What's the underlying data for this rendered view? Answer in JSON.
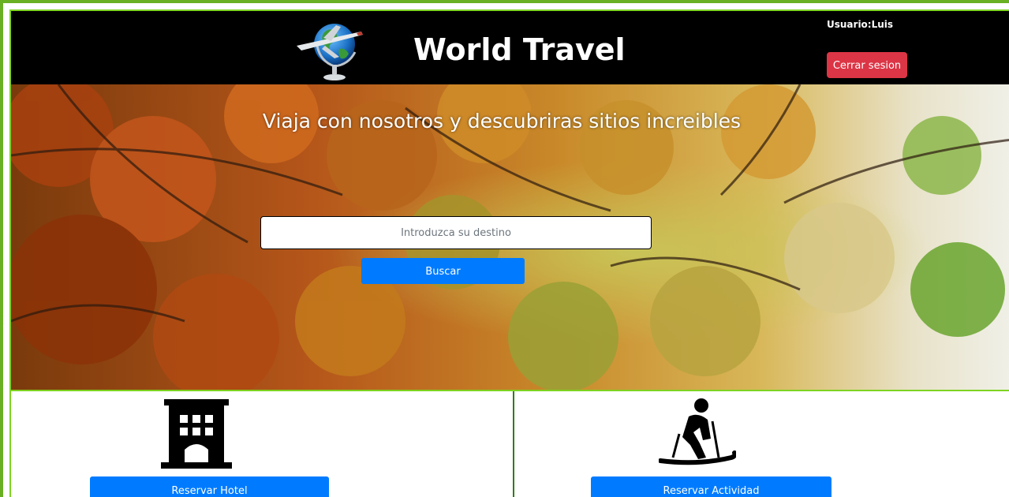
{
  "header": {
    "site_title": "World Travel",
    "user_label": "Usuario:Luis",
    "logout_label": "Cerrar sesion",
    "logo_icon": "globe-airplane-icon"
  },
  "hero": {
    "heading": "Viaja con nosotros y descubriras sitios increibles",
    "search_placeholder": "Introduzca su destino",
    "search_button": "Buscar",
    "background": "autumn-forest-photo"
  },
  "services": {
    "hotel": {
      "icon": "hotel-icon",
      "button_label": "Reservar Hotel"
    },
    "activity": {
      "icon": "skiing-icon",
      "button_label": "Reservar Actividad"
    }
  },
  "colors": {
    "frame_border": "#6ab023",
    "header_bg": "#000000",
    "primary": "#007bff",
    "danger": "#dc3545",
    "divider": "#2f7d16"
  }
}
